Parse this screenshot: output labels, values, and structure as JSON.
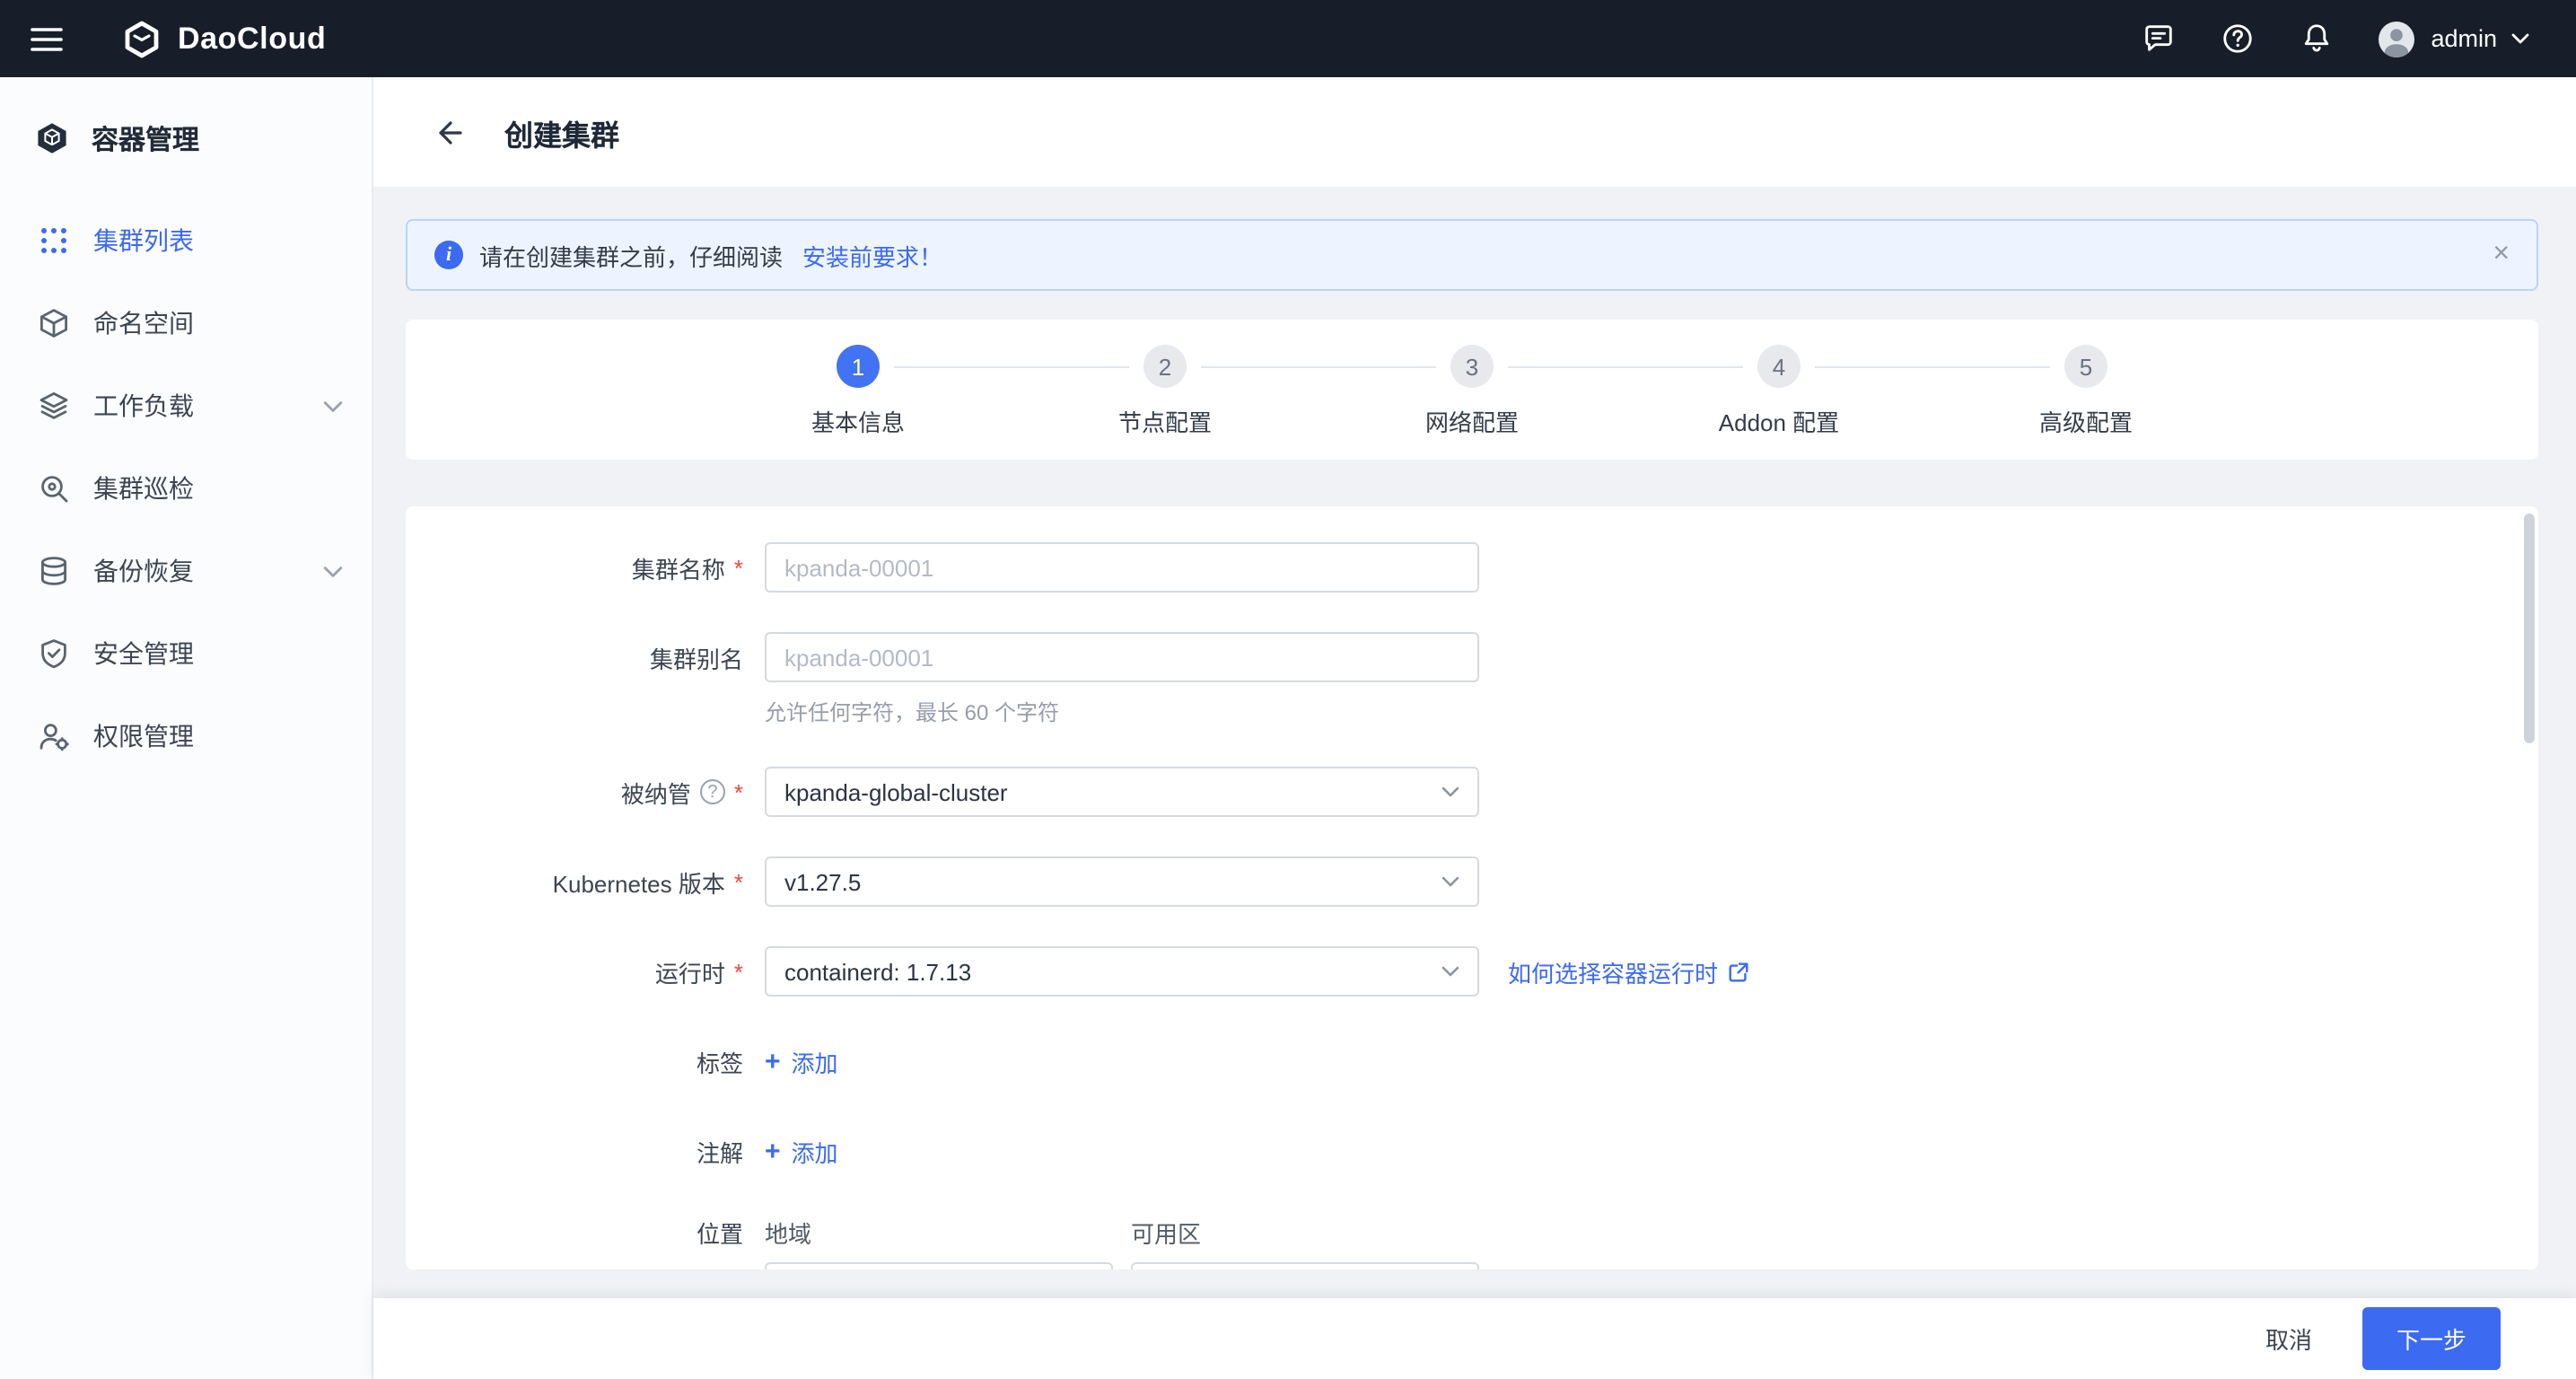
{
  "topbar": {
    "brand": "DaoCloud",
    "user": "admin"
  },
  "sidebar": {
    "title": "容器管理",
    "items": [
      {
        "label": "集群列表"
      },
      {
        "label": "命名空间"
      },
      {
        "label": "工作负载"
      },
      {
        "label": "集群巡检"
      },
      {
        "label": "备份恢复"
      },
      {
        "label": "安全管理"
      },
      {
        "label": "权限管理"
      }
    ]
  },
  "header": {
    "title": "创建集群"
  },
  "banner": {
    "text": "请在创建集群之前，仔细阅读",
    "link": "安装前要求！"
  },
  "stepper": {
    "steps": [
      {
        "num": "1",
        "label": "基本信息"
      },
      {
        "num": "2",
        "label": "节点配置"
      },
      {
        "num": "3",
        "label": "网络配置"
      },
      {
        "num": "4",
        "label": "Addon 配置"
      },
      {
        "num": "5",
        "label": "高级配置"
      }
    ]
  },
  "form": {
    "required_marker": "*",
    "cluster_name": {
      "label": "集群名称",
      "placeholder": "kpanda-00001"
    },
    "cluster_alias": {
      "label": "集群别名",
      "placeholder": "kpanda-00001",
      "hint": "允许任何字符，最长 60 个字符"
    },
    "managed_by": {
      "label": "被纳管",
      "value": "kpanda-global-cluster"
    },
    "k8s_version": {
      "label": "Kubernetes 版本",
      "value": "v1.27.5"
    },
    "runtime": {
      "label": "运行时",
      "value": "containerd: 1.7.13",
      "link": "如何选择容器运行时"
    },
    "labels_field": {
      "label": "标签",
      "add": "添加"
    },
    "annotations_field": {
      "label": "注解",
      "add": "添加"
    },
    "location": {
      "label": "位置",
      "region_label": "地域",
      "zone_label": "可用区"
    }
  },
  "footer": {
    "cancel": "取消",
    "next": "下一步"
  },
  "icons": {
    "info": "i",
    "close": "×",
    "plus": "+",
    "help": "?"
  },
  "colors": {
    "primary": "#3c6af0",
    "topbar_bg": "#171e29",
    "banner_bg": "#edf4ff",
    "required": "#f0483e"
  }
}
